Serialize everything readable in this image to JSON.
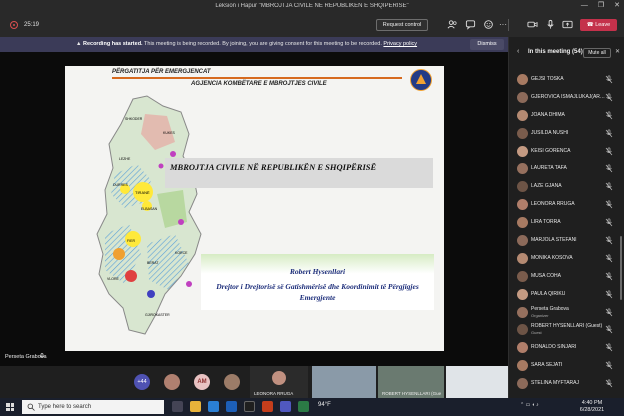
{
  "window": {
    "title": "Leksion i Hapur \"MBROJTJA CIVILE NË REPUBLIKËN E SHQIPËRISË\"",
    "controls": [
      "—",
      "❐",
      "✕"
    ]
  },
  "meeting_bar": {
    "timer": "25:19",
    "request_control_label": "Request control",
    "leave_label": "Leave"
  },
  "banner": {
    "heading": "Recording has started.",
    "message": "This meeting is being recorded. By joining, you are giving consent for this meeting to be recorded.",
    "link": "Privacy policy",
    "dismiss_label": "Dismiss"
  },
  "slide": {
    "header": "PËRGATITJA PËR EMERGJENCAT",
    "agency": "AGJENCIA KOMBËTARE E MBROJTJES CIVILE",
    "title": "MBROJTJA CIVILE NË REPUBLIKËN E SHQIPËRISË",
    "presenter": "Robert Hysenllari",
    "role": "Drejtor i Drejtorisë së Gatishmërisë dhe Koordinimit të Përgjigjes Emergjente",
    "map_labels": [
      "TIRANË",
      "ELBASAN",
      "DURRES",
      "FIER",
      "VLORE",
      "KUKES",
      "SHKODER",
      "LEZHE",
      "DIBER",
      "KORCE",
      "GJIROKASTER",
      "BERAT"
    ]
  },
  "stage": {
    "presenter_name": "Perseta Grabova"
  },
  "gallery": {
    "more_count": "+44",
    "am_initials": "AM",
    "tiles": [
      {
        "label": "LEONORA RRUGA"
      },
      {
        "label": ""
      },
      {
        "label": "ROBERT HYSENLLARI (Gue"
      },
      {
        "label": ""
      }
    ]
  },
  "panel": {
    "title": "In this meeting",
    "count": "(54)",
    "mute_all_label": "Mute all",
    "participants": [
      {
        "name": "GEJSI TOSKA",
        "sub": ""
      },
      {
        "name": "GJEROVICA ISMAJLUKAJ(ARE...",
        "sub": ""
      },
      {
        "name": "JOANA DHIMA",
        "sub": ""
      },
      {
        "name": "JUSILDA NUSHI",
        "sub": ""
      },
      {
        "name": "KEISI GORENCA",
        "sub": ""
      },
      {
        "name": "LAURETA TAFA",
        "sub": ""
      },
      {
        "name": "LAZE GJANA",
        "sub": ""
      },
      {
        "name": "LEONORA RRUGA",
        "sub": ""
      },
      {
        "name": "LIRA TORRA",
        "sub": ""
      },
      {
        "name": "MARJOLA STEFANI",
        "sub": ""
      },
      {
        "name": "MONIKA KOSOVA",
        "sub": ""
      },
      {
        "name": "MUSA COHA",
        "sub": ""
      },
      {
        "name": "PAULA QIRIKU",
        "sub": ""
      },
      {
        "name": "Perseta Grabova",
        "sub": "Organizer"
      },
      {
        "name": "ROBERT HYSENLLARI (Guest)",
        "sub": "Guest"
      },
      {
        "name": "RONALDO SINJARI",
        "sub": ""
      },
      {
        "name": "SARA SEJATI",
        "sub": ""
      },
      {
        "name": "STELINA MYFTARAJ",
        "sub": ""
      }
    ]
  },
  "taskbar": {
    "search_placeholder": "Type here to search",
    "weather": "94°F",
    "time": "4:40 PM",
    "date": "6/28/2021"
  },
  "colors": {
    "leave": "#c4314b",
    "banner": "#3b3b58",
    "accent": "#4f52b2"
  }
}
